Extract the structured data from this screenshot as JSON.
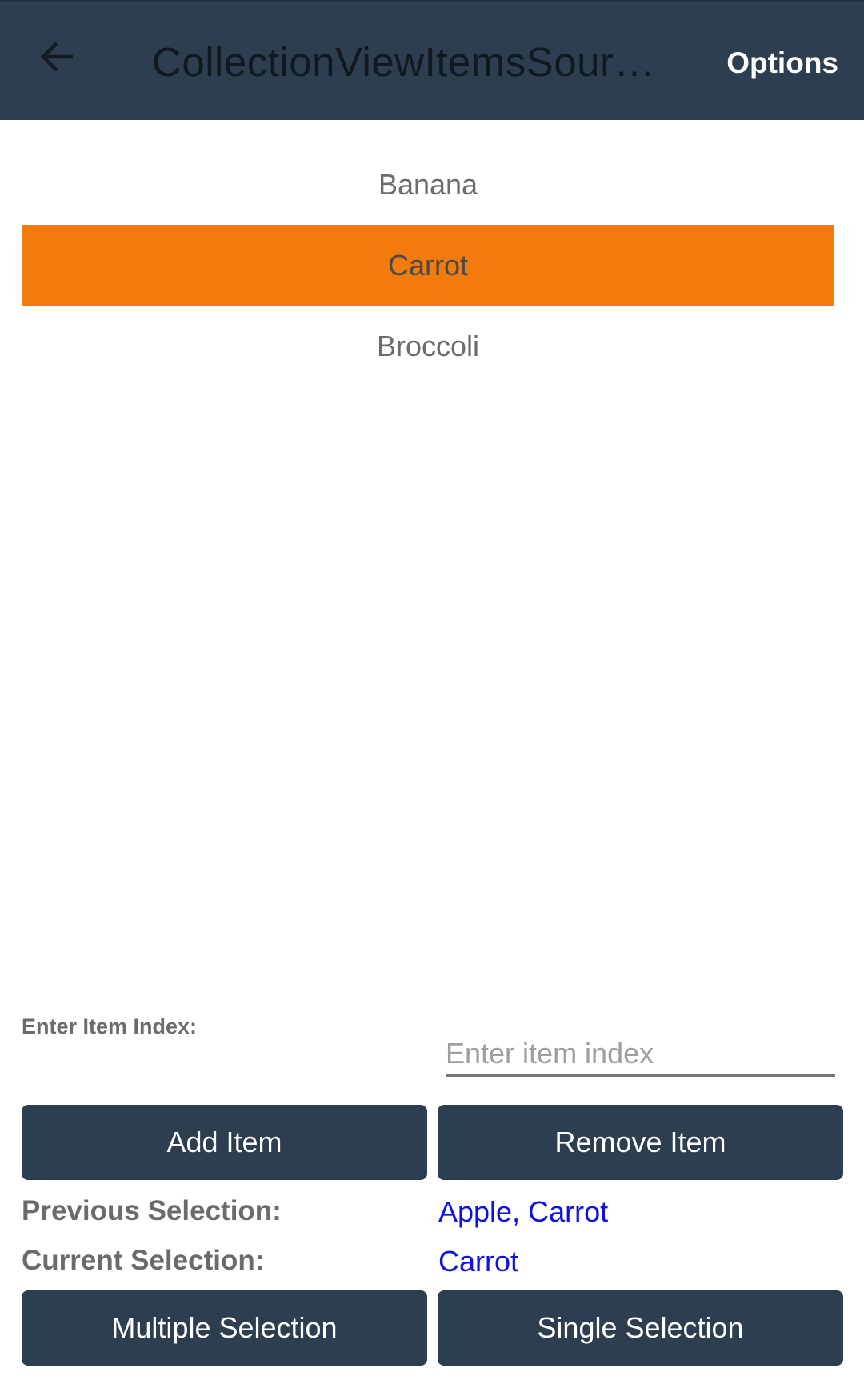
{
  "appbar": {
    "title": "CollectionViewItemsSour…",
    "options_label": "Options",
    "back_icon": "arrow-left-icon",
    "background": "#2d3e50"
  },
  "list": {
    "items": [
      {
        "label": "Banana",
        "selected": false
      },
      {
        "label": "Carrot",
        "selected": true
      },
      {
        "label": "Broccoli",
        "selected": false
      }
    ],
    "selected_color": "#f27b0c"
  },
  "index_entry": {
    "label": "Enter Item Index:",
    "placeholder": "Enter item index",
    "value": ""
  },
  "actions": {
    "add_label": "Add Item",
    "remove_label": "Remove Item",
    "multiple_label": "Multiple Selection",
    "single_label": "Single Selection"
  },
  "selection": {
    "previous_label": "Previous Selection:",
    "previous_value": "Apple, Carrot",
    "current_label": "Current Selection:",
    "current_value": "Carrot",
    "value_color": "#0a10e6"
  }
}
